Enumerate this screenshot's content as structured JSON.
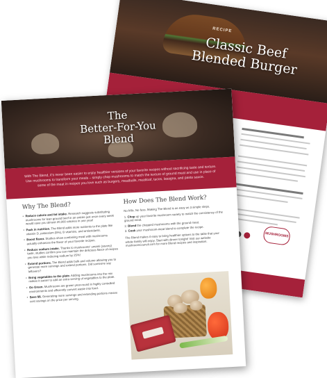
{
  "back_page": {
    "recipe_tag": "RECIPE",
    "title_line1": "Classic Beef",
    "title_line2": "Blended Burger"
  },
  "front_page": {
    "title_line1": "The",
    "title_line2": "Better-For-You",
    "title_line3": "Blend",
    "intro": "With The Blend, it's never been easier to enjoy healthier versions of your favorite recipes without sacrificing taste and texture. Use mushrooms to transform your meals – simply chop mushrooms to match the texture of ground meat and use in place of some of the meat in recipes you love such as burgers, meatballs, meatloaf, tacos, lasagna, and pasta sauce.",
    "why_title": "Why The Blend?",
    "why_bullets": [
      {
        "bold": "Reduce calorie and fat intake.",
        "text": " Research suggests substituting mushrooms for lean ground beef in an entrée just once every week would save you almost 20,000 calories in one year!"
      },
      {
        "bold": "Pack in nutrition.",
        "text": " The Blend adds more nutrients to the plate like vitamin D, potassium (5%), B vitamins, and antioxidants."
      },
      {
        "bold": "Boost flavor.",
        "text": " Studies show combining meat with mushrooms actually enhances the flavor of your favorite recipes."
      },
      {
        "bold": "Reduce sodium intake.",
        "text": " Thanks to mushrooms' umami (savory) taste, studies confirm you can maintain the delicious flavor of recipes you love while reducing sodium by 25%!"
      },
      {
        "bold": "Extend portions.",
        "text": " The Blend adds bulk and volume allowing you to generate more servings and extend portions. Did someone say leftovers?"
      },
      {
        "bold": "Bring vegetables to the plate.",
        "text": " Adding mushrooms into the mix makes it easier to add an extra serving of vegetables to the plate."
      },
      {
        "bold": "Go Green.",
        "text": " Mushrooms are grown year-round in highly controlled environments and efficiently convert waste into food."
      },
      {
        "bold": "Save $$.",
        "text": " Generating more servings and extending portions means cost savings on the price per serving."
      }
    ],
    "how_title": "How Does The Blend Work?",
    "how_intro": "No frills. No fuss. Making The Blend is as easy as 3 simple steps.",
    "steps": [
      {
        "bold": "Chop",
        "text": " up your favorite mushroom variety to match the consistency of the ground meat."
      },
      {
        "bold": "Blend",
        "text": " the chopped mushrooms with the ground meat."
      },
      {
        "bold": "Cook",
        "text": " your mushroom-meat blend to complete the recipe."
      }
    ],
    "how_outro": "The Blend makes it easy to bring healthier options to the table that your whole family will enjoy. Start with dinner tonight! Visit our website mushroomcouncil.com for more Blend recipes and inspiration."
  }
}
